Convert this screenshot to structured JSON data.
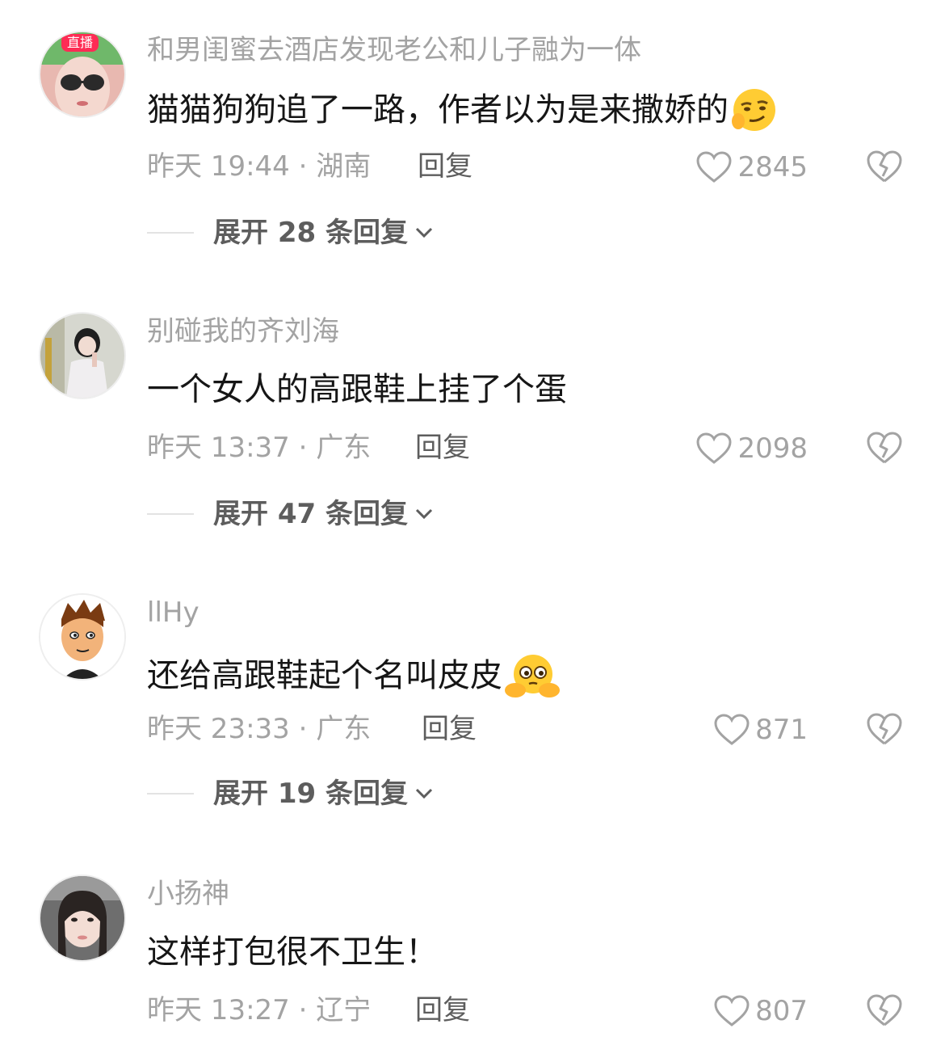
{
  "comments": [
    {
      "username": "和男闺蜜去酒店发现老公和儿子融为一体",
      "avatar_badge": "直播",
      "text": "猫猫狗狗追了一路，作者以为是来撒娇的",
      "emoji": "smirking-emoji",
      "time_location": "昨天 19:44 · 湖南",
      "reply_label": "回复",
      "likes": "2845",
      "expand_label": "展开 28 条回复"
    },
    {
      "username": "别碰我的齐刘海",
      "text": "一个女人的高跟鞋上挂了个蛋",
      "time_location": "昨天 13:37 · 广东",
      "reply_label": "回复",
      "likes": "2098",
      "expand_label": "展开 47 条回复"
    },
    {
      "username": "llHy",
      "text": "还给高跟鞋起个名叫皮皮",
      "emoji": "pleading-emoji",
      "time_location": "昨天 23:33 · 广东",
      "reply_label": "回复",
      "likes": "871",
      "expand_label": "展开 19 条回复"
    },
    {
      "username": "小扬神",
      "text": "这样打包很不卫生！",
      "time_location": "昨天 13:27 · 辽宁",
      "reply_label": "回复",
      "likes": "807"
    }
  ],
  "colors": {
    "secondary_text": "#a3a3a3",
    "primary_text": "#161616",
    "action_text": "#5d5d5d",
    "live_badge": "#fe2c55"
  },
  "icons": {
    "like": "heart-outline-icon",
    "dislike": "broken-heart-icon",
    "expand": "chevron-down-icon"
  }
}
